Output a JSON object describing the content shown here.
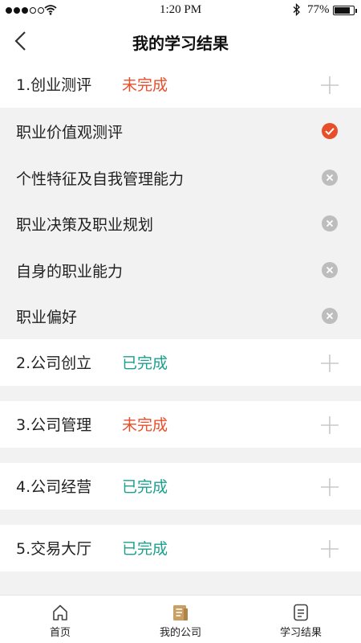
{
  "status_bar": {
    "time": "1:20 PM",
    "battery_pct": "77%",
    "battery_level": 0.77
  },
  "nav": {
    "title": "我的学习结果"
  },
  "colors": {
    "incomplete": "#e94e2a",
    "complete": "#1aa08c",
    "check": "#e94e2a",
    "cross": "#bdbdbd"
  },
  "sections": [
    {
      "title": "1.创业测评",
      "status": "未完成",
      "state": "incomplete"
    },
    {
      "title": "2.公司创立",
      "status": "已完成",
      "state": "complete"
    },
    {
      "title": "3.公司管理",
      "status": "未完成",
      "state": "incomplete"
    },
    {
      "title": "4.公司经营",
      "status": "已完成",
      "state": "complete"
    },
    {
      "title": "5.交易大厅",
      "status": "已完成",
      "state": "complete"
    }
  ],
  "sub_items": [
    {
      "label": "职业价值观测评",
      "icon": "check-icon"
    },
    {
      "label": "个性特征及自我管理能力",
      "icon": "cross-icon"
    },
    {
      "label": "职业决策及职业规划",
      "icon": "cross-icon"
    },
    {
      "label": "自身的职业能力",
      "icon": "cross-icon"
    },
    {
      "label": "职业偏好",
      "icon": "cross-icon"
    }
  ],
  "tabs": [
    {
      "label": "首页",
      "icon": "home-icon"
    },
    {
      "label": "我的公司",
      "icon": "company-icon"
    },
    {
      "label": "学习结果",
      "icon": "document-icon"
    }
  ]
}
